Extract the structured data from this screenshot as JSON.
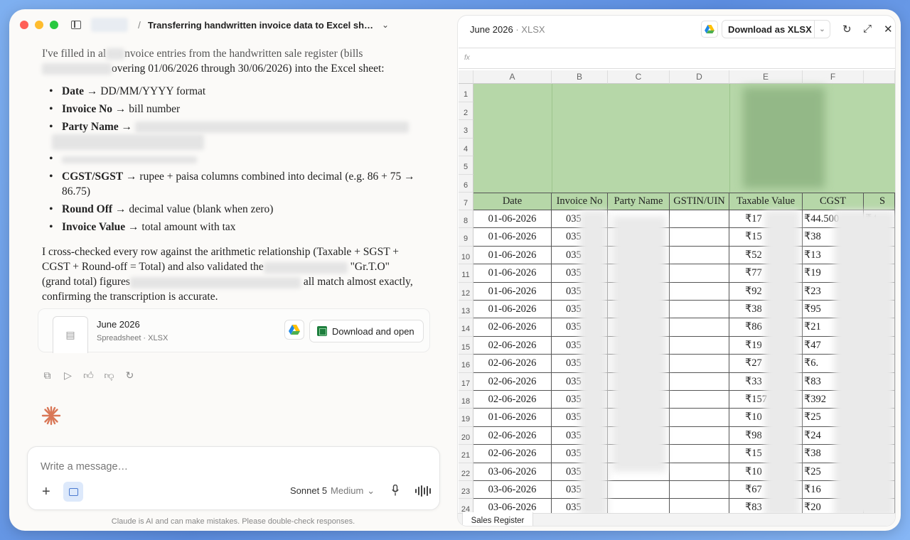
{
  "titlebar": {
    "conversation_title": "Transferring handwritten invoice data to Excel sh…"
  },
  "message": {
    "intro_a": "I've filled in al",
    "intro_b": "nvoice entries from the handwritten sale register (bills",
    "intro_c": "overing 01/06/2026 through 30/06/2026) into the Excel sheet:",
    "bullets": [
      {
        "bold": "Date",
        "text": " → DD/MM/YYYY format"
      },
      {
        "bold": "Invoice No",
        "text": " → bill number"
      },
      {
        "bold": "Party Name",
        "text": " →"
      },
      {
        "bold": "",
        "text": ""
      },
      {
        "bold": "CGST/SGST",
        "text": " → rupee + paisa columns combined into decimal (e.g. 86 + 75 → 86.75)"
      },
      {
        "bold": "Round Off",
        "text": " → decimal value (blank when zero)"
      },
      {
        "bold": "Invoice Value",
        "text": " → total amount with tax"
      }
    ],
    "para2_a": "I cross-checked every row against the arithmetic relationship (Taxable + SGST + CGST + Round-off = Total) and also validated the",
    "para2_b": "\"Gr.T.O\" (grand total) figures",
    "para2_c": "all match almost exactly, confirming the transcription is accurate."
  },
  "file_card": {
    "name": "June 2026",
    "meta": "Spreadsheet · XLSX",
    "download_label": "Download and open"
  },
  "composer": {
    "placeholder": "Write a message…",
    "model": "Sonnet 5",
    "effort": "Medium",
    "disclaimer": "Claude is AI and can make mistakes. Please double-check responses."
  },
  "panel": {
    "title": "June 2026",
    "ext": "· XLSX",
    "download_label": "Download as XLSX",
    "formula_prefix": "fx",
    "sheet_tab": "Sales Register"
  },
  "sheet": {
    "col_letters": [
      "A",
      "B",
      "C",
      "D",
      "E",
      "F"
    ],
    "row_numbers": [
      "1",
      "2",
      "3",
      "4",
      "5",
      "6",
      "7",
      "8",
      "9",
      "10",
      "11",
      "12",
      "13",
      "14",
      "15",
      "16",
      "17",
      "18",
      "19",
      "20",
      "21",
      "22",
      "23",
      "24"
    ],
    "headers": [
      "Date",
      "Invoice No",
      "Party Name",
      "GSTIN/UIN",
      "Taxable Value",
      "CGST",
      "S"
    ],
    "rows": [
      {
        "date": "01-06-2026",
        "inv": "035",
        "tax": "₹17",
        "cgst": "₹44.500",
        "s": "₹4"
      },
      {
        "date": "01-06-2026",
        "inv": "035",
        "tax": "₹15",
        "cgst": "₹38",
        "s": ""
      },
      {
        "date": "01-06-2026",
        "inv": "035",
        "tax": "₹52",
        "cgst": "₹13",
        "s": ""
      },
      {
        "date": "01-06-2026",
        "inv": "035",
        "tax": "₹77",
        "cgst": "₹19",
        "s": ""
      },
      {
        "date": "01-06-2026",
        "inv": "035",
        "tax": "₹92",
        "cgst": "₹23",
        "s": ""
      },
      {
        "date": "01-06-2026",
        "inv": "035",
        "tax": "₹38",
        "cgst": "₹95",
        "s": ""
      },
      {
        "date": "02-06-2026",
        "inv": "035",
        "tax": "₹86",
        "cgst": "₹21",
        "s": ""
      },
      {
        "date": "02-06-2026",
        "inv": "035",
        "tax": "₹19",
        "cgst": "₹47",
        "s": ""
      },
      {
        "date": "02-06-2026",
        "inv": "035",
        "tax": "₹27",
        "cgst": "₹6.",
        "s": ""
      },
      {
        "date": "02-06-2026",
        "inv": "035",
        "tax": "₹33",
        "cgst": "₹83",
        "s": ""
      },
      {
        "date": "02-06-2026",
        "inv": "035",
        "tax": "₹157",
        "cgst": "₹392",
        "s": ""
      },
      {
        "date": "01-06-2026",
        "inv": "035",
        "tax": "₹10",
        "cgst": "₹25",
        "s": ""
      },
      {
        "date": "02-06-2026",
        "inv": "035",
        "tax": "₹98",
        "cgst": "₹24",
        "s": ""
      },
      {
        "date": "02-06-2026",
        "inv": "035",
        "tax": "₹15",
        "cgst": "₹38",
        "s": ""
      },
      {
        "date": "03-06-2026",
        "inv": "035",
        "tax": "₹10",
        "cgst": "₹25",
        "s": ""
      },
      {
        "date": "03-06-2026",
        "inv": "035",
        "tax": "₹67",
        "cgst": "₹16",
        "s": ""
      },
      {
        "date": "03-06-2026",
        "inv": "035",
        "tax": "₹83",
        "cgst": "₹20",
        "s": ""
      }
    ]
  },
  "colors": {
    "header_green": "#b6d7a8",
    "accent_orange": "#d97757"
  }
}
